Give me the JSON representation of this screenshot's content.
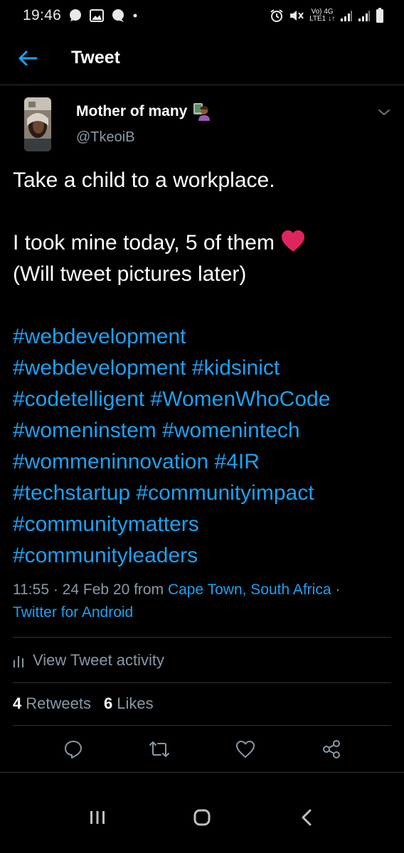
{
  "status_bar": {
    "time": "19:46",
    "network_top": "Vo) 4G",
    "network_bottom": "LTE1 ↓↑",
    "icons": [
      "whatsapp-icon",
      "gallery-icon",
      "message-icon",
      "dot-icon",
      "alarm-icon",
      "mute-icon",
      "signal-icon",
      "signal-icon",
      "battery-icon"
    ]
  },
  "header": {
    "title": "Tweet",
    "back_icon": "back-arrow-icon"
  },
  "tweet": {
    "author_name": "Mother of many",
    "author_handle": "@TkeoiB",
    "text_line_1": "Take a child to a workplace.",
    "text_line_2": "I took mine today, 5 of them",
    "text_line_3": "(Will tweet pictures later)",
    "hashtag_lines": [
      [
        "#webdevelopment"
      ],
      [
        "#webdevelopment",
        "#kidsinict"
      ],
      [
        "#codetelligent",
        "#WomenWhoCode"
      ],
      [
        "#womeninstem",
        "#womenintech"
      ],
      [
        "#wommeninnovation",
        "#4IR"
      ],
      [
        "#techstartup",
        "#communityimpact"
      ],
      [
        "#communitymatters"
      ],
      [
        "#communityleaders"
      ]
    ],
    "time": "11:55",
    "date": "24 Feb 20",
    "from_label": "from",
    "location": "Cape Town, South Africa",
    "source": "Twitter for Android"
  },
  "activity": {
    "label": "View Tweet activity"
  },
  "stats": {
    "retweets_count": "4",
    "retweets_label": "Retweets",
    "likes_count": "6",
    "likes_label": "Likes"
  },
  "actions": [
    "reply-icon",
    "retweet-icon",
    "like-icon",
    "share-icon"
  ],
  "colors": {
    "background": "#000000",
    "accent": "#1da1f2",
    "secondary_text": "#8899a6",
    "divider": "#2f3336",
    "heart": "#e0245e"
  }
}
